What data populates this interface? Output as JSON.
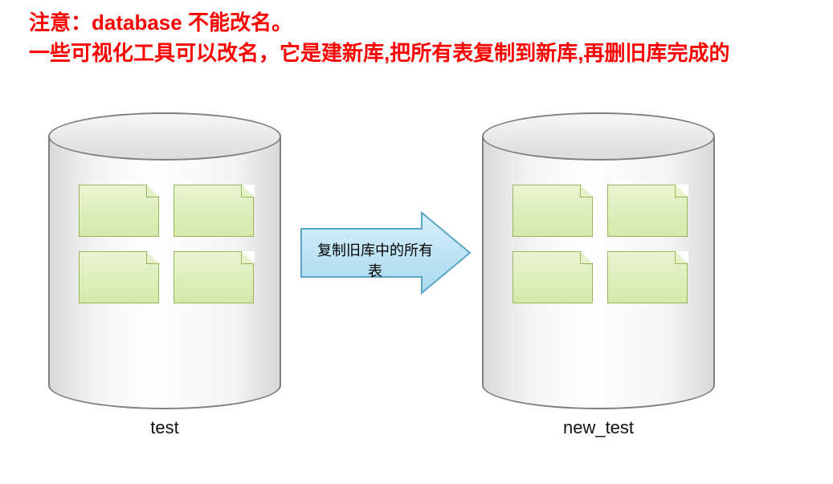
{
  "note": {
    "line1": "注意：database 不能改名。",
    "line2": "一些可视化工具可以改名，它是建新库,把所有表复制到新库,再删旧库完成的"
  },
  "databases": {
    "source": {
      "name": "test"
    },
    "target": {
      "name": "new_test"
    }
  },
  "arrow": {
    "label": "复制旧库中的所有表"
  },
  "colors": {
    "note_red": "#ff0000",
    "cylinder_border": "#7f7f7f",
    "table_fill_top": "#e9f4d1",
    "table_fill_bottom": "#d5e9a9",
    "table_border": "#98b65a",
    "arrow_fill_top": "#d7effb",
    "arrow_fill_bottom": "#a9d9ee",
    "arrow_border": "#5aa7c4"
  }
}
